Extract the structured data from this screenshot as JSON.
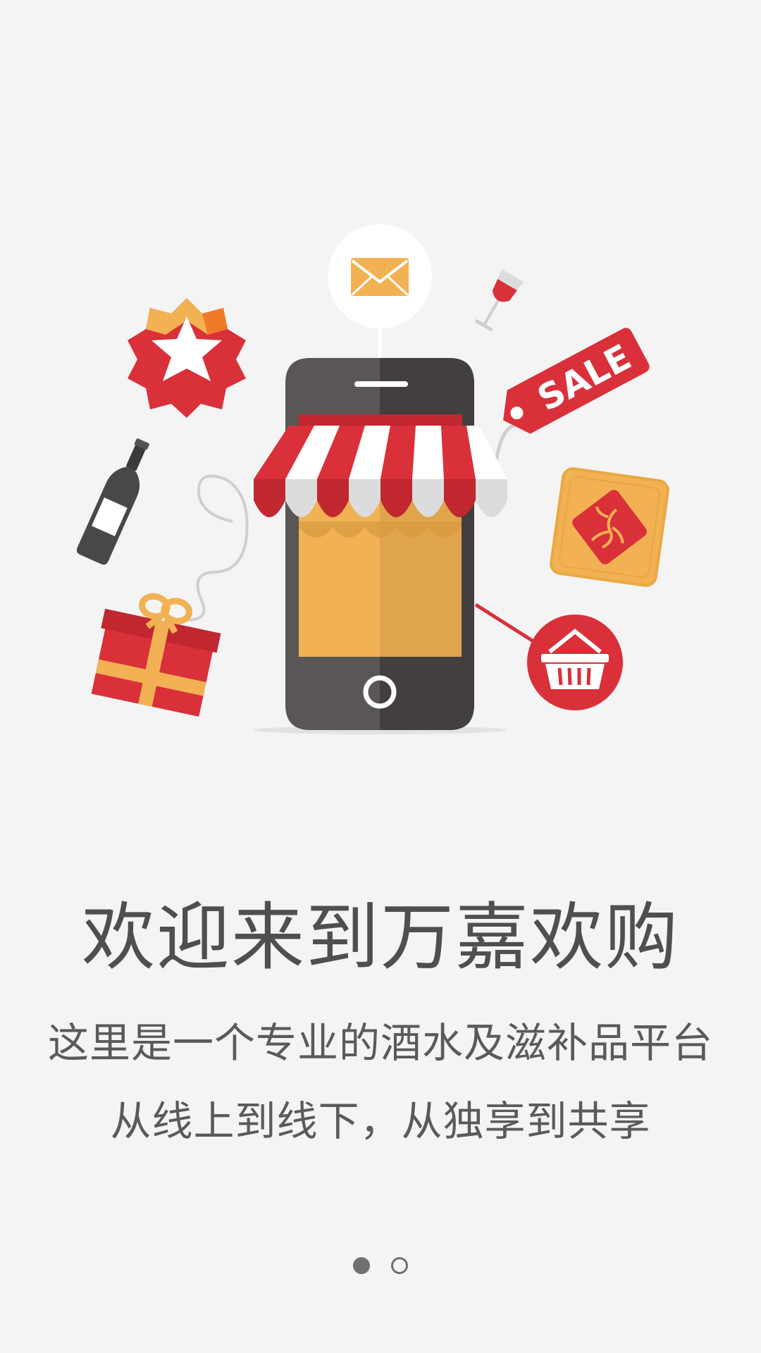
{
  "welcome": {
    "title": "欢迎来到万嘉欢购",
    "line1": "这里是一个专业的酒水及滋补品平台",
    "line2": "从线上到线下，从独享到共享"
  },
  "illustration": {
    "sale_tag_text": "SALE",
    "icons": [
      "envelope-icon",
      "wine-glass-icon",
      "sale-tag-icon",
      "badge-icon",
      "wine-bottle-icon",
      "gift-box-icon",
      "ginseng-card-icon",
      "shopping-basket-icon",
      "smartphone-store-icon"
    ]
  },
  "pager": {
    "page_count": 2,
    "active_index": 0
  },
  "colors": {
    "background": "#f4f4f4",
    "red": "#d9303a",
    "dark_red": "#c0272f",
    "orange": "#f2b153",
    "phone_dark": "#444040",
    "text": "#4f4f4f"
  }
}
